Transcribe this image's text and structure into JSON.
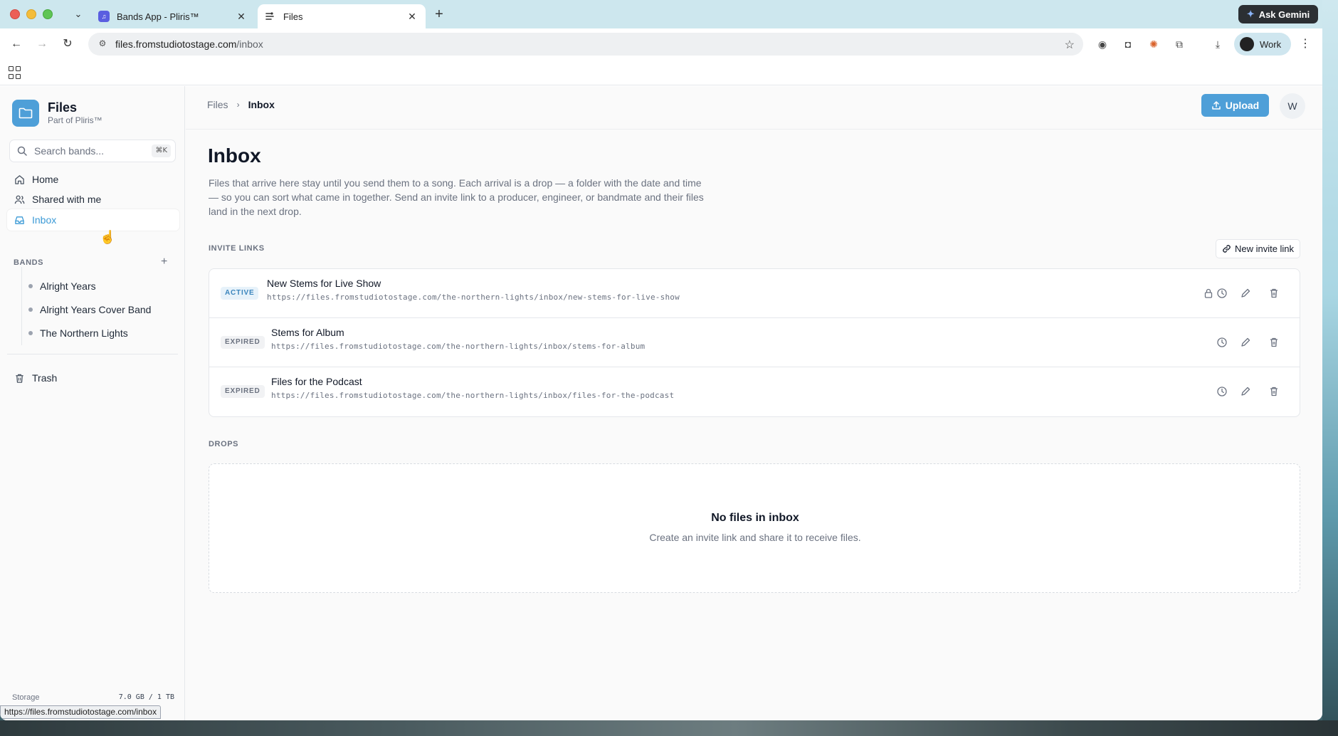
{
  "browser": {
    "tabs": [
      {
        "title": "Bands App - Pliris™",
        "active": false
      },
      {
        "title": "Files",
        "active": true
      }
    ],
    "ask_gemini": "Ask Gemini",
    "url_host": "files.fromstudiotostage.com",
    "url_path": "/inbox",
    "profile": "Work",
    "status_url": "https://files.fromstudiotostage.com/inbox"
  },
  "sidebar": {
    "app_title": "Files",
    "app_subtitle": "Part of Pliris™",
    "search_placeholder": "Search bands...",
    "search_shortcut": "⌘K",
    "nav": [
      {
        "label": "Home",
        "icon": "home-icon"
      },
      {
        "label": "Shared with me",
        "icon": "users-icon"
      },
      {
        "label": "Inbox",
        "icon": "inbox-icon",
        "selected": true
      }
    ],
    "bands_label": "BANDS",
    "bands": [
      "Alright Years",
      "Alright Years Cover Band",
      "The Northern Lights"
    ],
    "trash_label": "Trash",
    "storage_label": "Storage",
    "storage_value": "7.0 GB / 1 TB"
  },
  "header": {
    "breadcrumb": [
      "Files",
      "Inbox"
    ],
    "upload_label": "Upload",
    "user_initial": "W"
  },
  "main": {
    "title": "Inbox",
    "description": "Files that arrive here stay until you send them to a song. Each arrival is a drop — a folder with the date and time — so you can sort what came in together. Send an invite link to a producer, engineer, or bandmate and their files land in the next drop.",
    "invite_links_label": "INVITE LINKS",
    "new_invite_label": "New invite link",
    "invites": [
      {
        "status": "ACTIVE",
        "name": "New Stems for Live Show",
        "url": "https://files.fromstudiotostage.com/the-northern-lights/inbox/new-stems-for-live-show",
        "locked": true
      },
      {
        "status": "EXPIRED",
        "name": "Stems for Album",
        "url": "https://files.fromstudiotostage.com/the-northern-lights/inbox/stems-for-album",
        "locked": false
      },
      {
        "status": "EXPIRED",
        "name": "Files for the Podcast",
        "url": "https://files.fromstudiotostage.com/the-northern-lights/inbox/files-for-the-podcast",
        "locked": false
      }
    ],
    "drops_label": "DROPS",
    "empty_title": "No files in inbox",
    "empty_subtitle": "Create an invite link and share it to receive files."
  },
  "colors": {
    "accent": "#4e9fd8",
    "selected_text": "#3b9ad6",
    "active_badge_bg": "#e7f2fa",
    "tabbar_bg": "#cde7ee"
  }
}
